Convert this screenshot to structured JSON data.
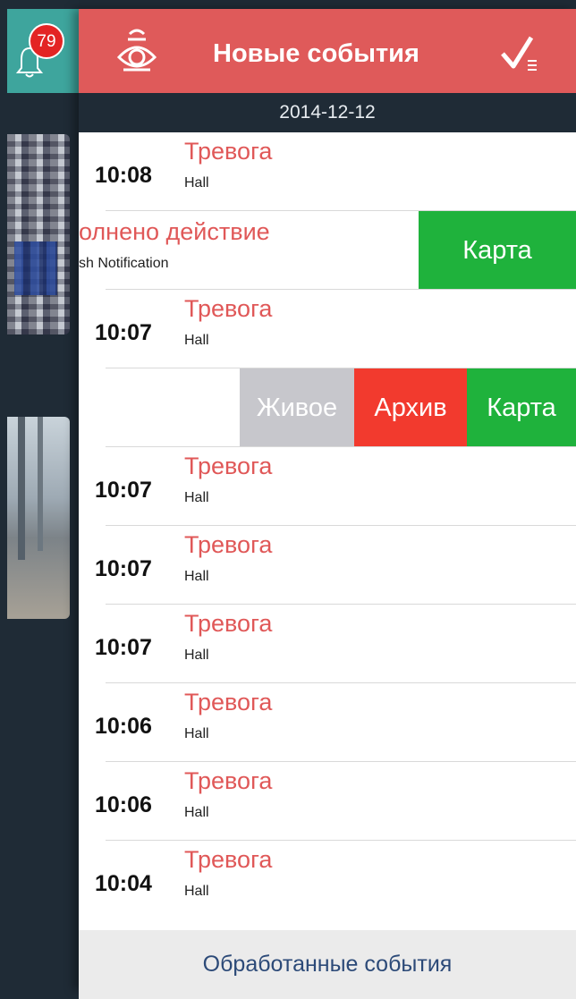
{
  "notifications": {
    "badge_count": "79",
    "bell_icon": "bell-icon"
  },
  "header": {
    "title": "Новые события",
    "eye_icon": "eye-icon",
    "check_icon": "check-list-icon",
    "color": "#df5a5a"
  },
  "date_bar": {
    "date": "2014-12-12"
  },
  "events": [
    {
      "time": "10:08",
      "type": "Тревога",
      "location": "Hall"
    },
    {
      "type": "олнено действие",
      "subtitle": "sh Notification",
      "actions": [
        "Карта"
      ]
    },
    {
      "time": "10:07",
      "type": "Тревога",
      "location": "Hall"
    },
    {
      "actions": [
        "Живое",
        "Архив",
        "Карта"
      ]
    },
    {
      "time": "10:07",
      "type": "Тревога",
      "location": "Hall"
    },
    {
      "time": "10:07",
      "type": "Тревога",
      "location": "Hall"
    },
    {
      "time": "10:07",
      "type": "Тревога",
      "location": "Hall"
    },
    {
      "time": "10:06",
      "type": "Тревога",
      "location": "Hall"
    },
    {
      "time": "10:06",
      "type": "Тревога",
      "location": "Hall"
    },
    {
      "time": "10:04",
      "type": "Тревога",
      "location": "Hall"
    }
  ],
  "footer": {
    "label": "Обработанные события"
  },
  "colors": {
    "alarm": "#e05858",
    "map": "#1fb23c",
    "archive": "#f23a2e",
    "live": "#c7c7cc",
    "sidebar": "#1f2b36",
    "bell_bg": "#3ea59d"
  }
}
